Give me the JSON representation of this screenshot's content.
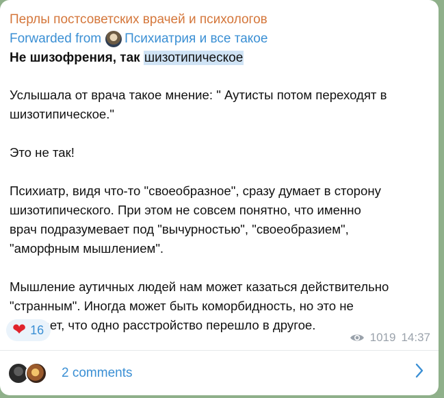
{
  "post": {
    "channel_title": "Перлы постсоветских врачей и психологов",
    "forwarded_prefix": "Forwarded from",
    "forwarded_source": "Психиатрия и все такое",
    "headline_plain": "Не шизофрения, так ",
    "headline_highlight": "шизотипическое",
    "paragraphs": [
      "Услышала от врача такое мнение: \" Аутисты потом переходят в\nшизотипическое.\"",
      "Это не так!",
      "Психиатр, видя что-то \"своеобразное\", сразу думает в сторону\nшизотипического.  При этом не совсем понятно, что именно\nврач подразумевает под \"вычурностью\", \"своеобразием\",\n\"аморфным мышлением\".",
      "Мышление аутичных людей нам может казаться действительно\n\"странным\". Иногда может быть коморбидность, но это не\nозначает, что одно расстройство перешло в другое."
    ]
  },
  "reaction": {
    "emoji": "❤",
    "count": "16"
  },
  "meta": {
    "views": "1019",
    "time": "14:37"
  },
  "comments": {
    "label": "2 comments"
  },
  "colors": {
    "title": "#d4763a",
    "link": "#3a8fd4",
    "highlight": "#cfe3f5",
    "heart": "#e0242d"
  },
  "icons": {
    "views": "eye-icon",
    "open_comments": "chevron-right-icon",
    "reaction": "heart-icon"
  }
}
